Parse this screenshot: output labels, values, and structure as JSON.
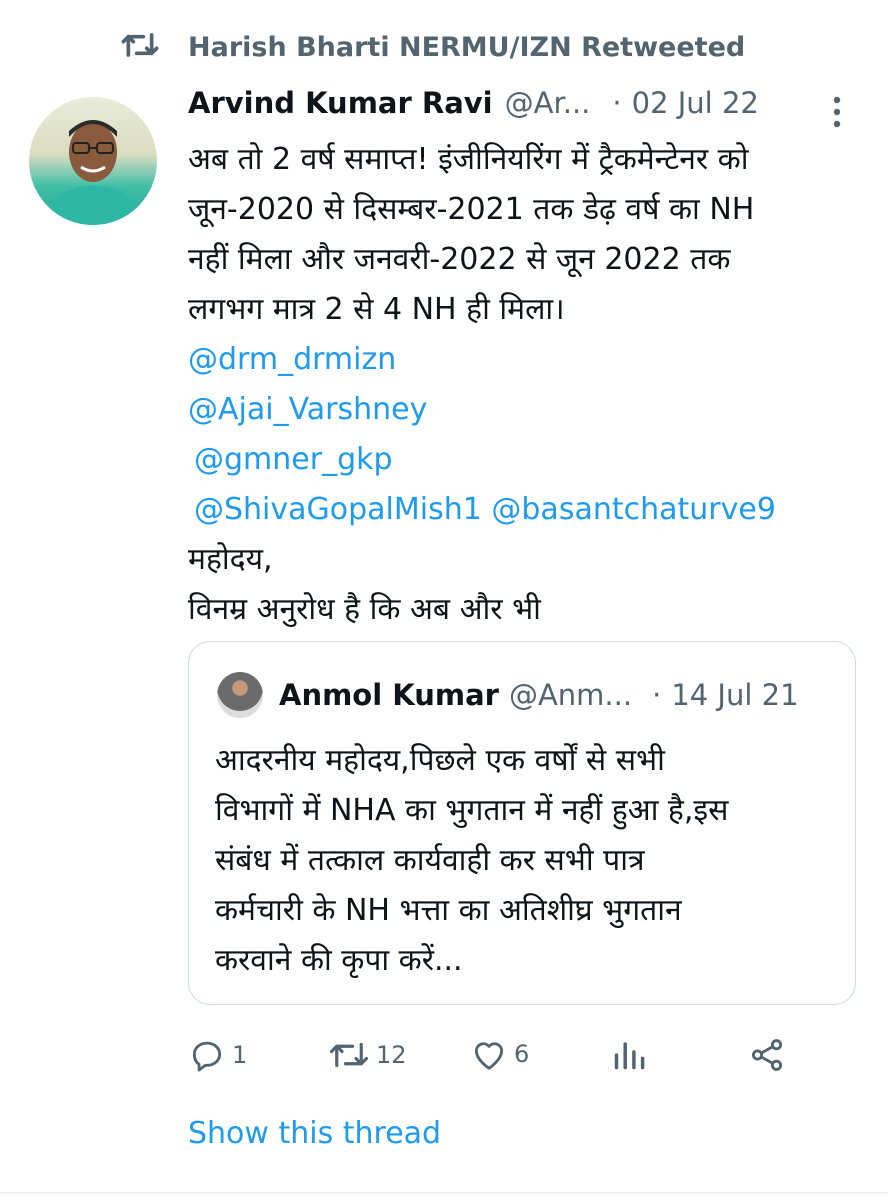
{
  "retweet_banner": {
    "icon": "retweet-icon",
    "text": "Harish Bharti NERMU/IZN Retweeted"
  },
  "tweet": {
    "author_name": "Arvind Kumar Ravi",
    "handle": "@Ar...",
    "separator": "·",
    "date": "02 Jul 22",
    "more_icon": "more-vertical-icon",
    "lines": [
      "अब तो 2 वर्ष समाप्त! इंजीनियरिंग में ट्रैकमेन्टेनर को",
      "जून-2020 से दिसम्बर-2021 तक डेढ़ वर्ष का NH",
      "नहीं मिला और जनवरी-2022 से जून 2022 तक",
      "लगभग मात्र 2 से 4 NH ही मिला।"
    ],
    "mentions": {
      "m1": "@drm_drmizn",
      "m2": "@Ajai_Varshney",
      "m3": "@gmner_gkp",
      "m4": "@ShivaGopalMish1",
      "m5": "@basantchaturve9"
    },
    "closing_lines": [
      "महोदय,",
      "विनम्र अनुरोध है कि अब और भी"
    ]
  },
  "quote": {
    "author_name": "Anmol Kumar",
    "handle": "@Anm...",
    "separator": "·",
    "date": "14 Jul 21",
    "lines": [
      "आदरनीय महोदय,पिछले एक वर्षों से सभी",
      "विभागों में NHA का भुगतान में नहीं हुआ है,इस",
      "संबंध में तत्काल कार्यवाही कर सभी पात्र",
      "कर्मचारी के NH भत्ता का अतिशीघ्र भुगतान",
      "करवाने की कृपा करें..."
    ]
  },
  "actions": {
    "reply": {
      "icon": "reply-icon",
      "count": "1"
    },
    "retweet": {
      "icon": "retweet-icon",
      "count": "12"
    },
    "like": {
      "icon": "heart-icon",
      "count": "6"
    },
    "analytics": {
      "icon": "analytics-icon"
    },
    "share": {
      "icon": "share-icon"
    }
  },
  "show_thread": "Show this thread",
  "colors": {
    "text": "#0f1419",
    "secondary": "#536471",
    "link": "#1d9bf0",
    "border": "#cfd9de"
  }
}
